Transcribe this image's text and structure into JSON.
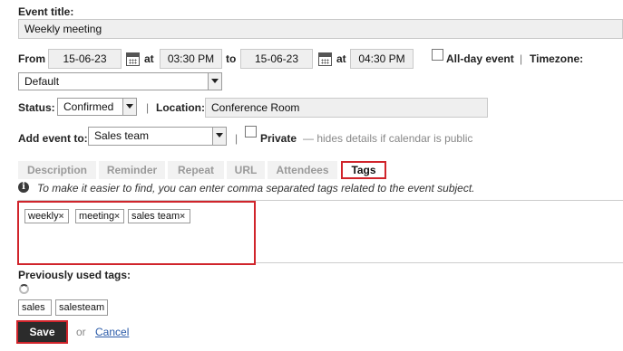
{
  "event_title": {
    "label": "Event title:",
    "value": "Weekly meeting"
  },
  "when": {
    "from_label": "From",
    "from_date": "15-06-23",
    "at_label": "at",
    "from_time": "03:30 PM",
    "to_label": "to",
    "to_date": "15-06-23",
    "to_time": "04:30 PM",
    "allday_label": "All-day event",
    "separator": "|",
    "timezone_label": "Timezone:",
    "timezone_value": "Default"
  },
  "status": {
    "label": "Status:",
    "value": "Confirmed"
  },
  "location": {
    "label": "Location:",
    "value": "Conference Room"
  },
  "add_event": {
    "label": "Add event to:",
    "value": "Sales team",
    "private_label": "Private",
    "private_hint": "— hides details if calendar is public"
  },
  "tabs": [
    {
      "label": "Description"
    },
    {
      "label": "Reminder"
    },
    {
      "label": "Repeat"
    },
    {
      "label": "URL"
    },
    {
      "label": "Attendees"
    },
    {
      "label": "Tags"
    }
  ],
  "tags_info": "To make it easier to find, you can enter comma separated tags related to the event subject.",
  "current_tags": [
    "weekly",
    "meeting",
    "sales team"
  ],
  "remove_glyph": "×",
  "previous": {
    "label": "Previously used tags:",
    "tags": [
      "sales",
      "salesteam"
    ]
  },
  "actions": {
    "save": "Save",
    "or": "or",
    "cancel": "Cancel"
  },
  "colors": {
    "highlight": "#d0242b",
    "link": "#2a5aa8"
  }
}
